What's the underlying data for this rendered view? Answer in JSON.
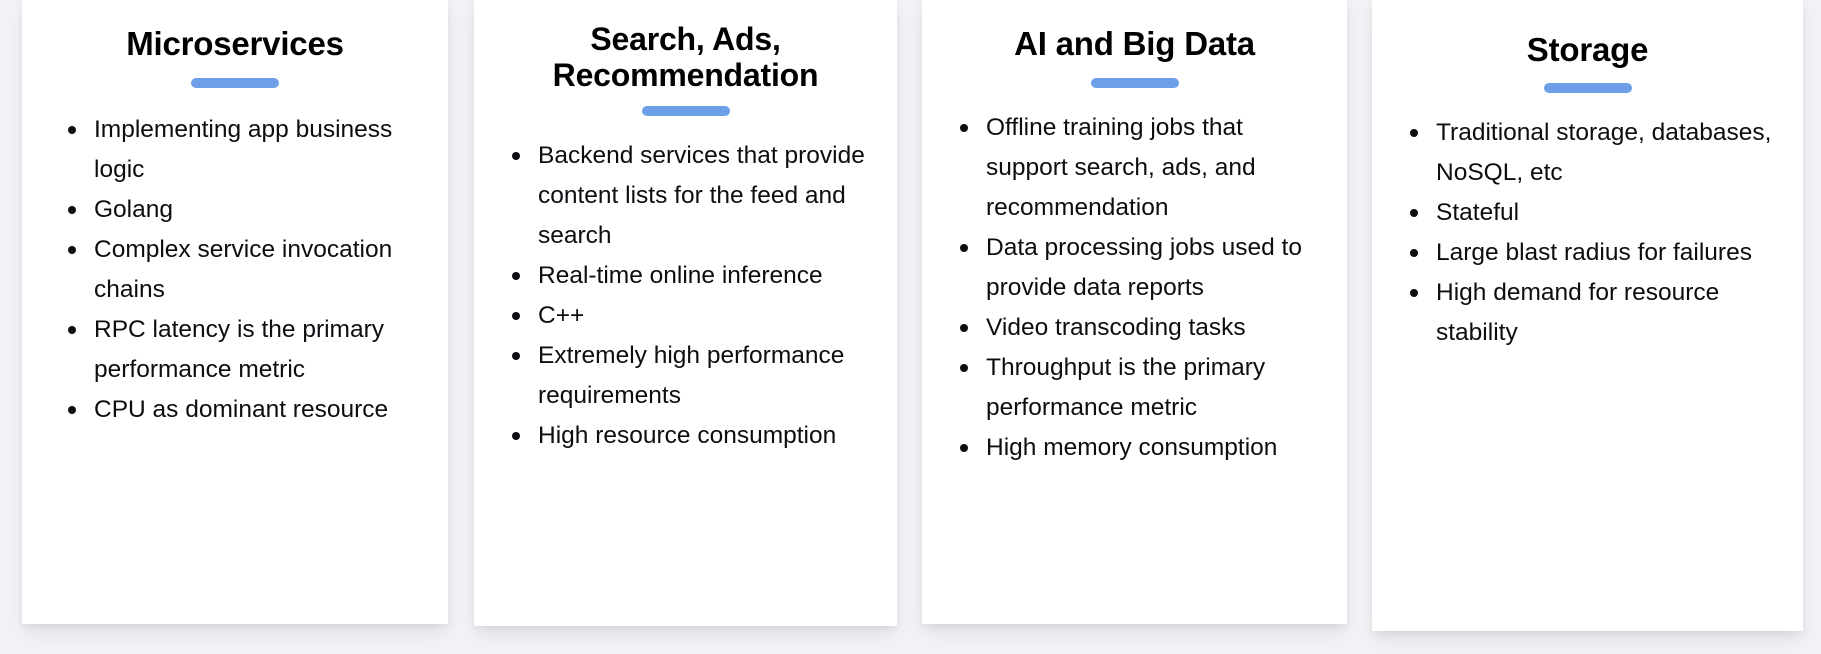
{
  "theme": {
    "page_background": "#f1f2f5",
    "card_background": "#ffffff",
    "divider_color": "#6d9ee8",
    "text_color": "#0d0d12"
  },
  "cards": [
    {
      "title": "Microservices",
      "items": [
        "Implementing app business logic",
        "Golang",
        "Complex service invocation chains",
        "RPC latency is the primary performance metric",
        "CPU as dominant resource"
      ]
    },
    {
      "title": "Search, Ads, Recommendation",
      "items": [
        "Backend services that provide content lists for the feed and search",
        "Real-time online inference",
        "C++",
        "Extremely high performance requirements",
        "High resource consumption"
      ]
    },
    {
      "title": "AI and Big Data",
      "items": [
        "Offline training jobs that support search, ads, and recommendation",
        "Data processing jobs used to provide data reports",
        "Video transcoding tasks",
        "Throughput is the primary performance metric",
        "High memory consumption"
      ]
    },
    {
      "title": "Storage",
      "items": [
        "Traditional storage, databases, NoSQL, etc",
        "Stateful",
        "Large blast radius for failures",
        "High demand for resource stability"
      ]
    }
  ]
}
